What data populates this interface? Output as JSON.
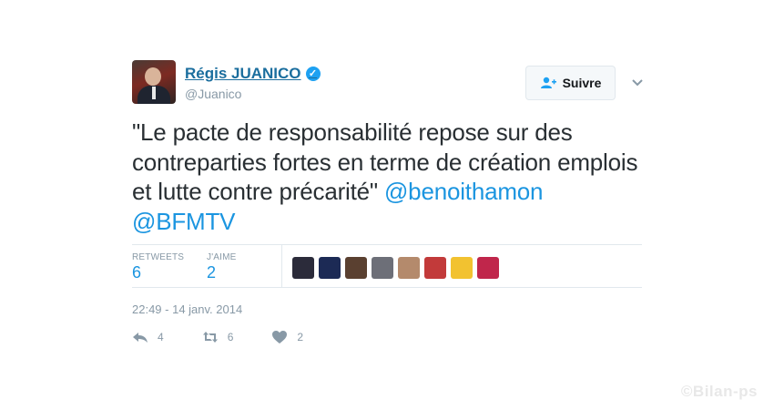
{
  "author": {
    "name": "Régis JUANICO",
    "handle": "@Juanico",
    "verified_icon": "check-badge-icon"
  },
  "follow_button": {
    "label": "Suivre",
    "icon": "add-user-icon"
  },
  "tweet": {
    "text": "\"Le pacte de responsabilité repose sur des contreparties fortes en terme de création emplois et lutte contre précarité\" ",
    "mention_1": "@benoithamon",
    "mention_2": "@BFMTV"
  },
  "stats": {
    "retweets_label": "RETWEETS",
    "retweets_value": "6",
    "likes_label": "J'AIME",
    "likes_value": "2"
  },
  "likers": [
    {
      "name": "liker-avatar-1",
      "color": "#2b2b3a"
    },
    {
      "name": "liker-avatar-2",
      "color": "#1c2a55"
    },
    {
      "name": "liker-avatar-3",
      "color": "#5a4030"
    },
    {
      "name": "liker-avatar-4",
      "color": "#6d6f78"
    },
    {
      "name": "liker-avatar-5",
      "color": "#b48a6c"
    },
    {
      "name": "liker-avatar-6",
      "color": "#c23a3a"
    },
    {
      "name": "liker-avatar-7",
      "color": "#f2c230"
    },
    {
      "name": "liker-avatar-8",
      "color": "#c0264b"
    }
  ],
  "timestamp": "22:49 - 14 janv. 2014",
  "actions": {
    "reply_count": "4",
    "retweet_count": "6",
    "like_count": "2"
  },
  "watermark": "©Bilan-ps",
  "colors": {
    "link": "#1b95e0",
    "name": "#1b6e9e",
    "muted": "#8899a6",
    "border": "#e1e8ed"
  }
}
